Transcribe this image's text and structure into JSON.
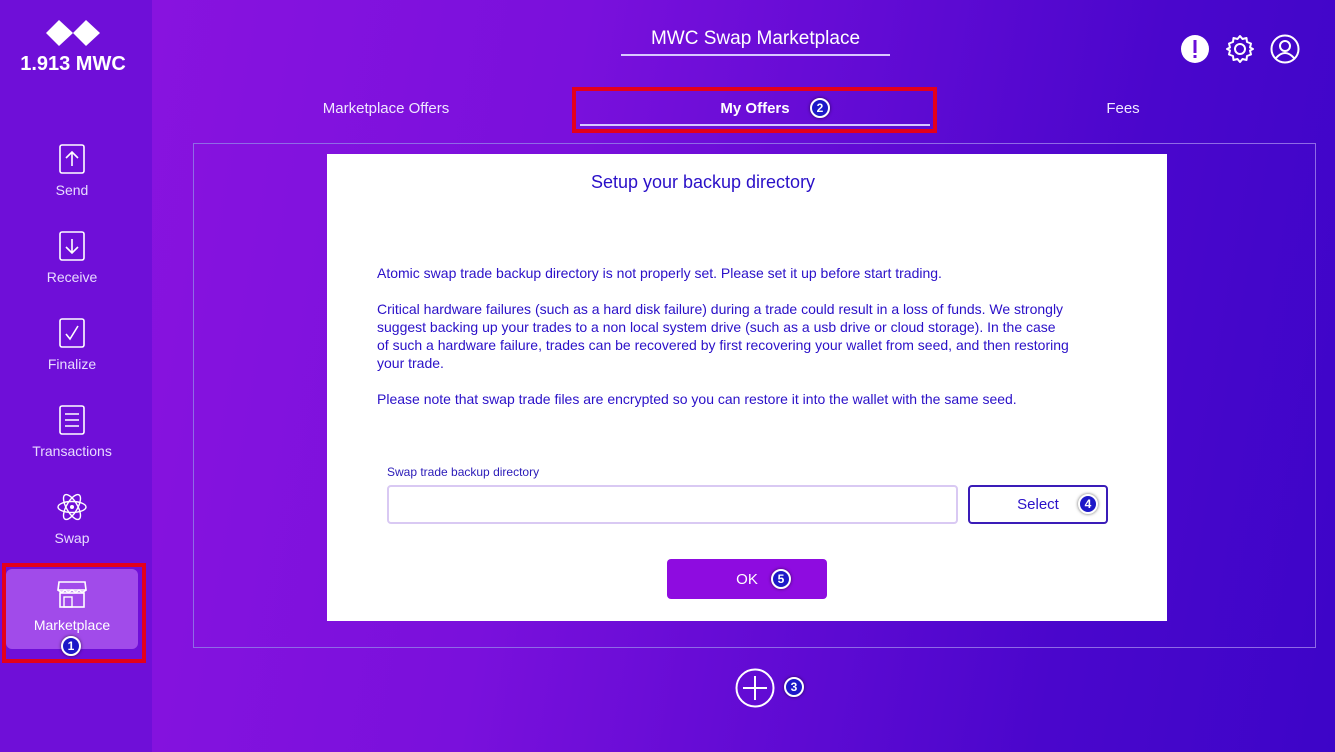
{
  "sidebar": {
    "balance": "1.913 MWC",
    "items": [
      {
        "label": "Send",
        "icon": "send-icon"
      },
      {
        "label": "Receive",
        "icon": "receive-icon"
      },
      {
        "label": "Finalize",
        "icon": "finalize-icon"
      },
      {
        "label": "Transactions",
        "icon": "transactions-icon"
      },
      {
        "label": "Swap",
        "icon": "swap-icon"
      },
      {
        "label": "Marketplace",
        "icon": "marketplace-icon",
        "active": true
      }
    ]
  },
  "header": {
    "title": "MWC Swap Marketplace",
    "icons": [
      "alert-icon",
      "settings-icon",
      "account-icon"
    ]
  },
  "tabs": [
    {
      "label": "Marketplace Offers"
    },
    {
      "label": "My Offers",
      "active": true
    },
    {
      "label": "Fees"
    }
  ],
  "dialog": {
    "title": "Setup your backup directory",
    "paragraph1": "Atomic swap trade backup directory is not properly set.  Please set it up before start trading.",
    "paragraph2_lines": [
      "Critical hardware failures (such as a hard disk failure) during a trade could result in a loss of funds. We strongly",
      "suggest backing up your trades to a non local system drive (such as a usb drive or cloud storage). In the case",
      "of such a hardware failure, trades can be recovered by first recovering your wallet from seed, and then restoring",
      "your trade."
    ],
    "paragraph3": "Please note that swap trade files are encrypted so you can restore it into the wallet with the same seed.",
    "field_label": "Swap trade backup directory",
    "field_value": "",
    "select_label": "Select",
    "ok_label": "OK"
  },
  "badges": [
    "1",
    "2",
    "3",
    "4",
    "5"
  ],
  "colors": {
    "sidebar": "#6f0fd8",
    "accent": "#8e0ce0",
    "dialog_text": "#2a10c8",
    "highlight": "#e4001b"
  }
}
